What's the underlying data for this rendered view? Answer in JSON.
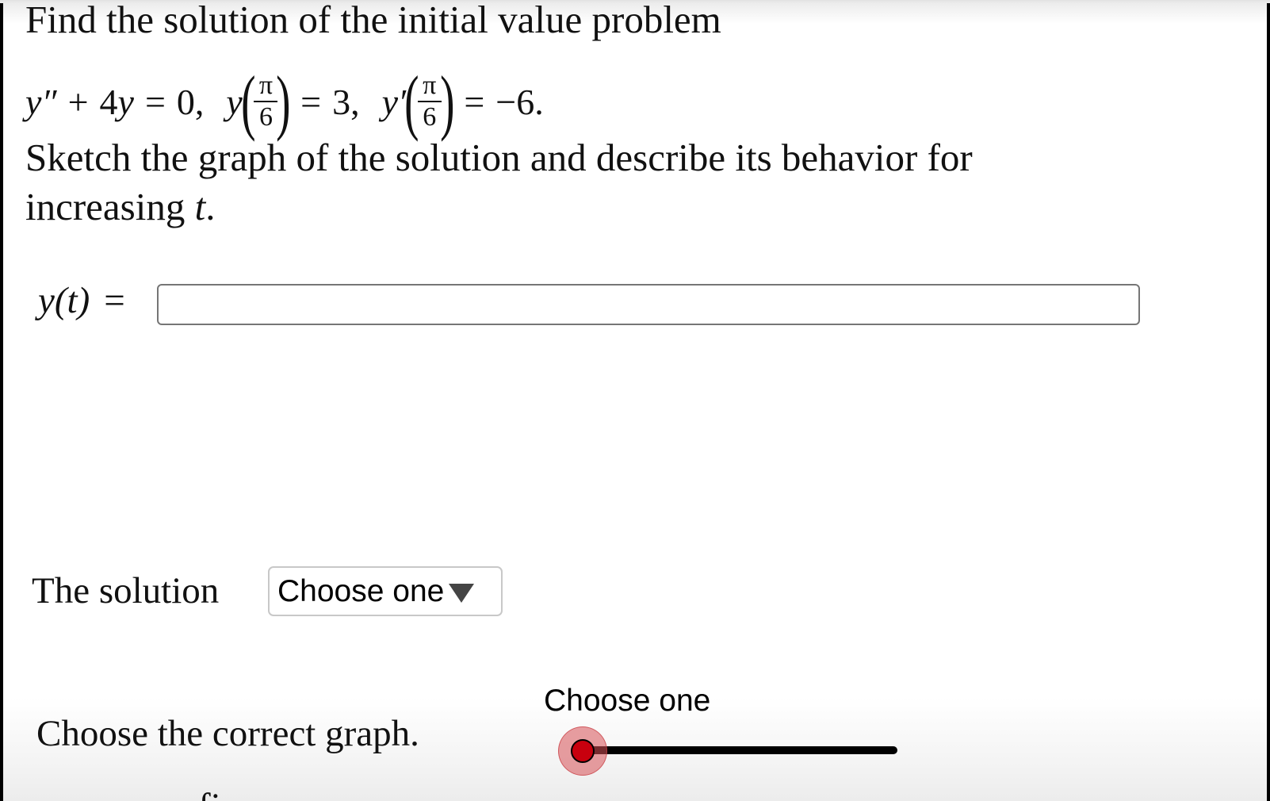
{
  "question": {
    "line1": "Find the solution of the initial value problem",
    "ode": {
      "lhs_y2": "y″",
      "plus": "+",
      "coef": "4",
      "y": "y",
      "eq": "=",
      "rhs": "0,",
      "ic1_func": "y",
      "ic1_num": "π",
      "ic1_den": "6",
      "ic1_eq": "=",
      "ic1_val": "3,",
      "ic2_func": "y′",
      "ic2_num": "π",
      "ic2_den": "6",
      "ic2_eq": "=",
      "ic2_val": "−6."
    },
    "line3": "Sketch the graph of the solution and describe its behavior for",
    "line4_text": "increasing ",
    "line4_var": "t",
    "line4_end": "."
  },
  "answer": {
    "label_func": "y(t)",
    "label_eq": "=",
    "input_value": "",
    "input_placeholder": ""
  },
  "behavior": {
    "label": "The solution",
    "select_value": "Choose one"
  },
  "graph_choice": {
    "label": "Choose the correct graph.",
    "slider_caption": "Choose one",
    "slider_value_fraction": 0.0,
    "knob_color": "#c8000e",
    "halo_color": "#d75055"
  }
}
